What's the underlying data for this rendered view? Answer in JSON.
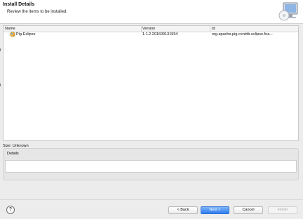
{
  "header": {
    "title": "Install Details",
    "subtitle": "Review the items to be installed."
  },
  "icons": {
    "banner": "install-wizard-icon",
    "feature": "feature-icon",
    "help": "help-icon"
  },
  "table": {
    "columns": [
      "Name",
      "Version",
      "Id"
    ],
    "rows": [
      {
        "name": "Pig-Eclipse",
        "version": "1.1.2.201609131554",
        "id": "org.apache.pig.contrib.eclipse.fea..."
      }
    ]
  },
  "size": {
    "label": "Size: Unknown"
  },
  "details": {
    "label": "Details",
    "text": ""
  },
  "footer": {
    "help_glyph": "?",
    "back_label": "< Back",
    "next_label": "Next >",
    "cancel_label": "Cancel",
    "finish_label": "Finish"
  },
  "colors": {
    "primary_button": "#2f7df0",
    "window_background": "#ececec"
  }
}
